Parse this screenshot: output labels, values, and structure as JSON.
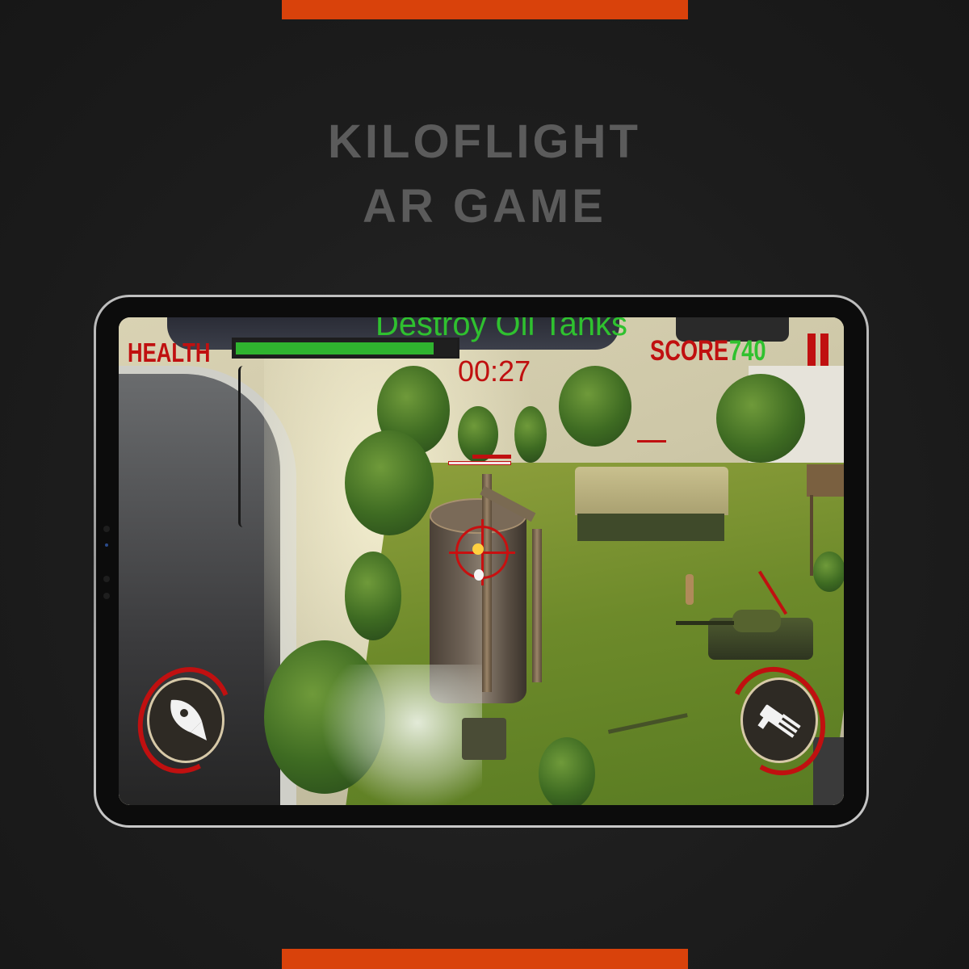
{
  "page": {
    "title_line1": "KILOFLIGHT",
    "title_line2": "AR GAME",
    "accent_color": "#d9420b"
  },
  "hud": {
    "health_label": "HEALTH",
    "health_level": 0.9,
    "objective": "Destroy Oil Tanks",
    "timer": "00:27",
    "score_label": "SCORE",
    "score_value": "740",
    "pause_icon": "pause-icon",
    "missile_icon": "rocket-icon",
    "gun_icon": "minigun-icon",
    "hud_red": "#c01010",
    "hud_green": "#2fc12f"
  }
}
